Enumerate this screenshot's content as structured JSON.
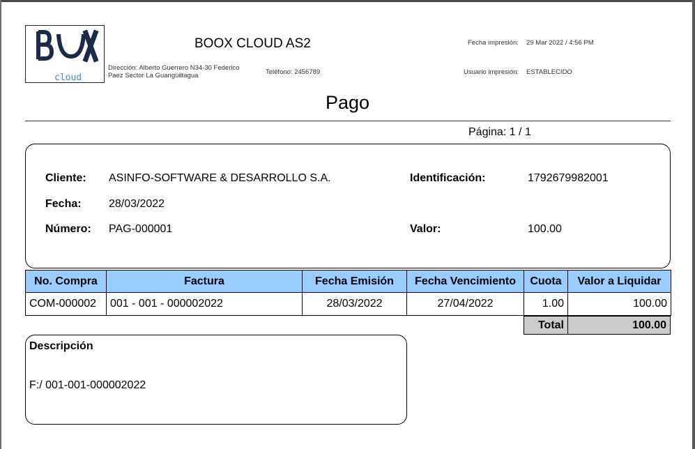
{
  "header": {
    "logo_text": "BOOX",
    "logo_sub": "cloud",
    "company": "BOOX CLOUD AS2",
    "address_line1": "Dirección: Alberto Guerrero N34-30 Federico",
    "address_line2": "Paez Sector La Guangüiltagua",
    "phone": "Teléfono: 2456789",
    "print_date_label": "Fecha impresión:",
    "print_date_value": "29 Mar 2022 / 4:56 PM",
    "print_user_label": "Usuario impresión:",
    "print_user_value": "ESTABLECIDO"
  },
  "document": {
    "title": "Pago",
    "page": "Página: 1 / 1"
  },
  "client": {
    "cliente_label": "Cliente:",
    "cliente_value": "ASINFO-SOFTWARE & DESARROLLO S.A.",
    "fecha_label": "Fecha:",
    "fecha_value": "28/03/2022",
    "numero_label": "Número:",
    "numero_value": "PAG-000001",
    "identificacion_label": "Identificación:",
    "identificacion_value": "1792679982001",
    "valor_label": "Valor:",
    "valor_value": "100.00"
  },
  "table": {
    "headers": [
      "No. Compra",
      "Factura",
      "Fecha Emisión",
      "Fecha Vencimiento",
      "Cuota",
      "Valor a Liquidar"
    ],
    "rows": [
      [
        "COM-000002",
        "001 - 001 - 000002022",
        "28/03/2022",
        "27/04/2022",
        "1.00",
        "100.00"
      ]
    ],
    "total_label": "Total",
    "total_value": "100.00"
  },
  "description": {
    "label": "Descripción",
    "text": "F:/ 001-001-000002022"
  },
  "colors": {
    "header_fill": "#99ccff",
    "total_fill": "#cccccc",
    "logo_dark": "#1a2a4a",
    "logo_blue": "#2f8fd0"
  }
}
